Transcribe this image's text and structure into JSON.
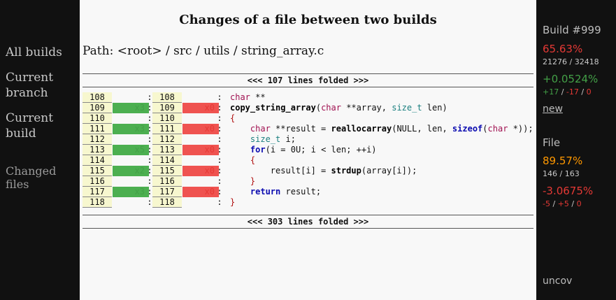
{
  "nav": {
    "all_builds": "All builds",
    "current_branch": "Current\nbranch",
    "current_build": "Current\nbuild",
    "changed_files": "Changed\nfiles"
  },
  "header": {
    "title": "Changes of a file between two builds",
    "path": "Path: <root> / src / utils / string_array.c"
  },
  "fold_top": "<<< 107 lines folded >>>",
  "fold_bottom": "<<< 303 lines folded >>>",
  "rows": [
    {
      "old": "108",
      "hit": "",
      "new": "108",
      "miss": "",
      "src": "char **"
    },
    {
      "old": "109",
      "hit": "x3",
      "new": "109",
      "miss": "x0",
      "src": "copy_string_array(char **array, size_t len)"
    },
    {
      "old": "110",
      "hit": "",
      "new": "110",
      "miss": "",
      "src": "{"
    },
    {
      "old": "111",
      "hit": "x3",
      "new": "111",
      "miss": "x0",
      "src": "    char **result = reallocarray(NULL, len, sizeof(char *));"
    },
    {
      "old": "112",
      "hit": "",
      "new": "112",
      "miss": "",
      "src": "    size_t i;"
    },
    {
      "old": "113",
      "hit": "x5",
      "new": "113",
      "miss": "x0",
      "src": "    for(i = 0U; i < len; ++i)"
    },
    {
      "old": "114",
      "hit": "",
      "new": "114",
      "miss": "",
      "src": "    {"
    },
    {
      "old": "115",
      "hit": "x2",
      "new": "115",
      "miss": "x0",
      "src": "        result[i] = strdup(array[i]);"
    },
    {
      "old": "116",
      "hit": "",
      "new": "116",
      "miss": "",
      "src": "    }"
    },
    {
      "old": "117",
      "hit": "x3",
      "new": "117",
      "miss": "x0",
      "src": "    return result;"
    },
    {
      "old": "118",
      "hit": "",
      "new": "118",
      "miss": "",
      "src": "}"
    }
  ],
  "sidebar": {
    "build_label": "Build #999",
    "build_coverage": "65.63%",
    "build_lines": "21276 / 32418",
    "build_delta": "+0.0524%",
    "build_delta_plus": "+17",
    "build_delta_minus": "-17",
    "build_delta_zero": "0",
    "new_link": "new",
    "file_label": "File",
    "file_coverage": "89.57%",
    "file_lines": "146 / 163",
    "file_delta": "-3.0675%",
    "file_delta_minus": "-5",
    "file_delta_plus": "+5",
    "file_delta_zero": "0",
    "uncov_link": "uncov"
  },
  "colors": {
    "hit_green": "#4caf50",
    "miss_red": "#ef5350",
    "line_number_bg": "#f7f7cf",
    "sidebar_bg": "#111111"
  }
}
